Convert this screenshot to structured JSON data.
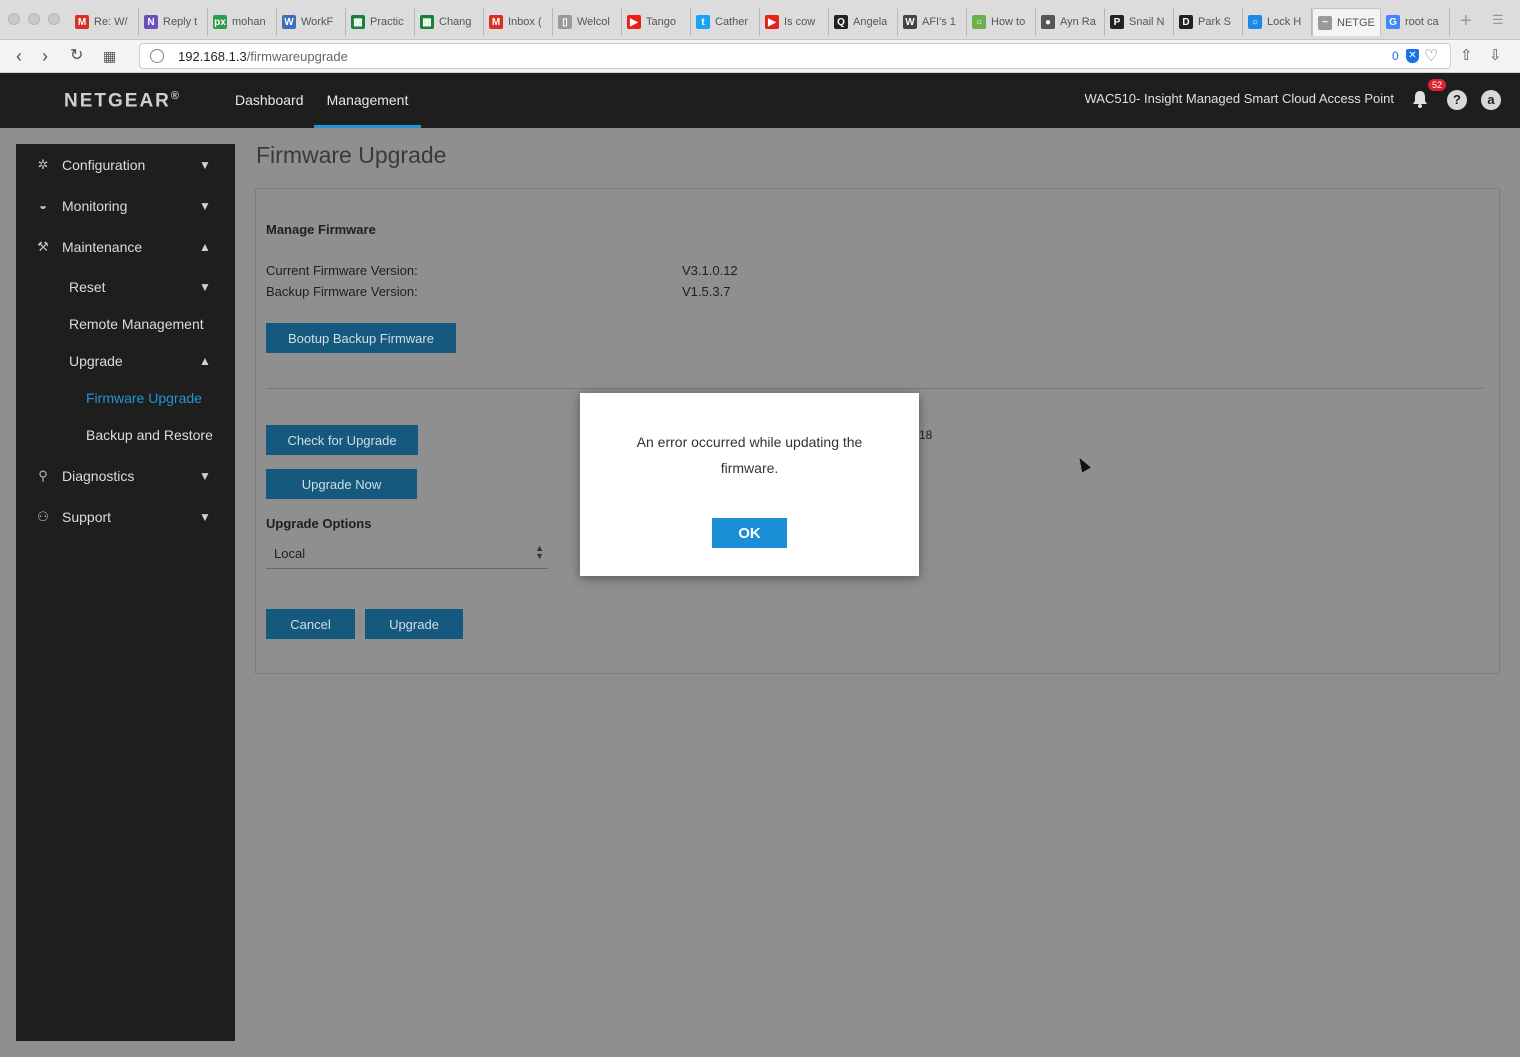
{
  "browser": {
    "tabs": [
      {
        "label": "Re: W/",
        "icon": "gmail-icon",
        "color": "#d93025",
        "glyph": "M"
      },
      {
        "label": "Reply t",
        "icon": "app-icon",
        "color": "#6b4fbb",
        "glyph": "N"
      },
      {
        "label": "mohan",
        "icon": "px-icon",
        "color": "#2e9c4b",
        "glyph": "px"
      },
      {
        "label": "WorkF",
        "icon": "workflow-icon",
        "color": "#3b6fb6",
        "glyph": "W"
      },
      {
        "label": "Practic",
        "icon": "sheets-icon",
        "color": "#188038",
        "glyph": "▦"
      },
      {
        "label": "Chang",
        "icon": "sheets-icon",
        "color": "#188038",
        "glyph": "▦"
      },
      {
        "label": "Inbox (",
        "icon": "gmail-icon",
        "color": "#d93025",
        "glyph": "M"
      },
      {
        "label": "Welcol",
        "icon": "page-icon",
        "color": "#9a9a9a",
        "glyph": "▯"
      },
      {
        "label": "Tango",
        "icon": "youtube-icon",
        "color": "#e62117",
        "glyph": "▶"
      },
      {
        "label": "Cather",
        "icon": "twitter-icon",
        "color": "#1da1f2",
        "glyph": "t"
      },
      {
        "label": "Is cow",
        "icon": "youtube-icon",
        "color": "#e62117",
        "glyph": "▶"
      },
      {
        "label": "Angela",
        "icon": "quora-icon",
        "color": "#222222",
        "glyph": "Q"
      },
      {
        "label": "AFI's 1",
        "icon": "wikipedia-icon",
        "color": "#444444",
        "glyph": "W"
      },
      {
        "label": "How to",
        "icon": "bulb-icon",
        "color": "#6ab04c",
        "glyph": "○"
      },
      {
        "label": "Ayn Ra",
        "icon": "avatar-icon",
        "color": "#555555",
        "glyph": "●"
      },
      {
        "label": "Snail N",
        "icon": "p-icon",
        "color": "#222222",
        "glyph": "P"
      },
      {
        "label": "Park S",
        "icon": "pd-icon",
        "color": "#222222",
        "glyph": "D"
      },
      {
        "label": "Lock H",
        "icon": "ring-icon",
        "color": "#1e88e5",
        "glyph": "○"
      },
      {
        "label": "NETGE",
        "icon": "netgear-icon",
        "color": "#9a9a9a",
        "glyph": "~",
        "active": true
      },
      {
        "label": "root ca",
        "icon": "google-icon",
        "color": "#4285f4",
        "glyph": "G"
      }
    ],
    "new_tab": "+",
    "url_host": "192.168.1.3",
    "url_path": "/firmwareupgrade",
    "tracker_count": "0"
  },
  "header": {
    "logo": "NETGEAR",
    "logo_mark": "®",
    "nav": {
      "dashboard": "Dashboard",
      "management": "Management"
    },
    "device_name": "WAC510- Insight Managed Smart Cloud Access Point",
    "notification_count": "52",
    "help": "?",
    "user_initial": "a"
  },
  "sidebar": {
    "configuration": "Configuration",
    "monitoring": "Monitoring",
    "maintenance": "Maintenance",
    "reset": "Reset",
    "remote_management": "Remote Management",
    "upgrade": "Upgrade",
    "firmware_upgrade": "Firmware Upgrade",
    "backup_restore": "Backup and Restore",
    "diagnostics": "Diagnostics",
    "support": "Support"
  },
  "main": {
    "title": "Firmware Upgrade",
    "section_title": "Manage Firmware",
    "current_label": "Current Firmware Version:",
    "current_value": "V3.1.0.12",
    "backup_label": "Backup Firmware Version:",
    "backup_value": "V1.5.3.7",
    "bootup_button": "Bootup Backup Firmware",
    "check_button": "Check for Upgrade",
    "upgrade_now_button": "Upgrade Now",
    "options_label": "Upgrade Options",
    "options_value": "Local",
    "cancel_button": "Cancel",
    "upgrade_button": "Upgrade",
    "obscured_fragment": "18"
  },
  "modal": {
    "message": "An error occurred while updating the firmware.",
    "ok": "OK"
  }
}
